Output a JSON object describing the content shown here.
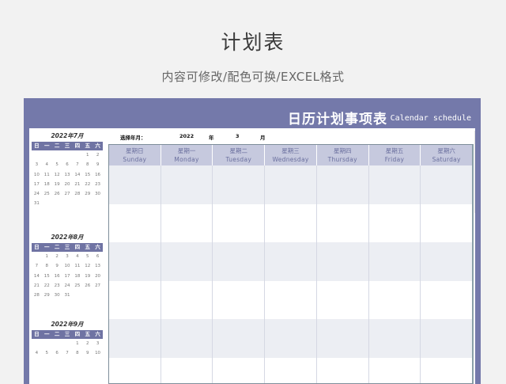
{
  "page": {
    "title": "计划表",
    "subtitle": "内容可修改/配色可换/EXCEL格式"
  },
  "sheet": {
    "title": "日历计划事项表",
    "title_en": "Calendar schedule",
    "accent_color": "#7479aa"
  },
  "selector": {
    "label": "选择年月：",
    "year": "2022",
    "year_unit": "年",
    "month": "3",
    "month_unit": "月"
  },
  "weekday_short": [
    "日",
    "一",
    "二",
    "三",
    "四",
    "五",
    "六"
  ],
  "mini_calendars": [
    {
      "title": "2022年7月",
      "days": [
        "",
        "",
        "",
        "",
        "",
        "1",
        "2",
        "3",
        "4",
        "5",
        "6",
        "7",
        "8",
        "9",
        "10",
        "11",
        "12",
        "13",
        "14",
        "15",
        "16",
        "17",
        "18",
        "19",
        "20",
        "21",
        "22",
        "23",
        "24",
        "25",
        "26",
        "27",
        "28",
        "29",
        "30",
        "31"
      ]
    },
    {
      "title": "2022年8月",
      "days": [
        "",
        "1",
        "2",
        "3",
        "4",
        "5",
        "6",
        "7",
        "8",
        "9",
        "10",
        "11",
        "12",
        "13",
        "14",
        "15",
        "16",
        "17",
        "18",
        "19",
        "20",
        "21",
        "22",
        "23",
        "24",
        "25",
        "26",
        "27",
        "28",
        "29",
        "30",
        "31"
      ]
    },
    {
      "title": "2022年9月",
      "days": [
        "",
        "",
        "",
        "",
        "1",
        "2",
        "3",
        "4",
        "5",
        "6",
        "7",
        "8",
        "9",
        "10"
      ]
    }
  ],
  "weekdays": [
    {
      "cn": "星期日",
      "en": "Sunday"
    },
    {
      "cn": "星期一",
      "en": "Monday"
    },
    {
      "cn": "星期二",
      "en": "Tuesday"
    },
    {
      "cn": "星期三",
      "en": "Wednesday"
    },
    {
      "cn": "星期四",
      "en": "Thursday"
    },
    {
      "cn": "星期五",
      "en": "Friday"
    },
    {
      "cn": "星期六",
      "en": "Saturday"
    }
  ]
}
